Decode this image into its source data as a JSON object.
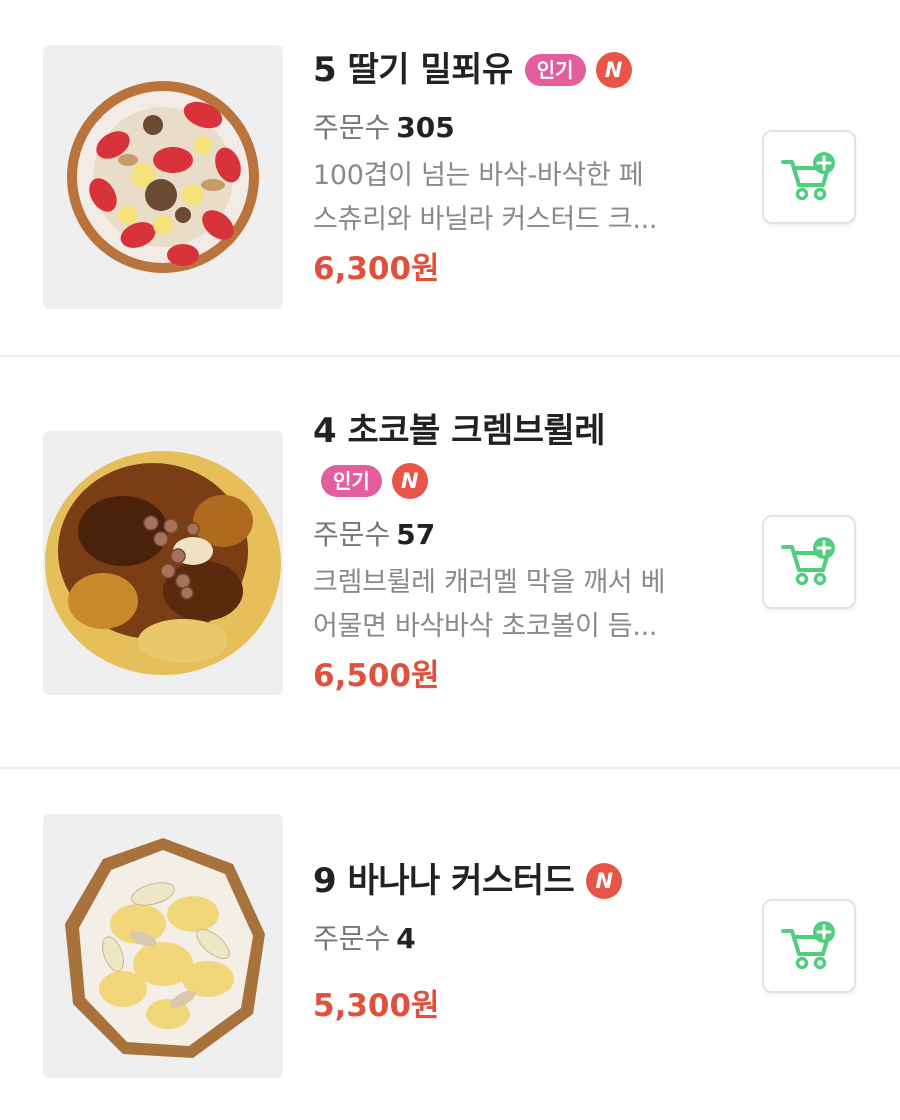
{
  "theme": {
    "price_color": "#e0503d",
    "popular_badge_color": "#e45d9e",
    "new_badge_color": "#e85447",
    "cart_icon_color": "#4fcf7e"
  },
  "menu_items": [
    {
      "title": "5 딸기 밀푀유",
      "badge_popular": "인기",
      "badge_new": "N",
      "orders_label": "주문수",
      "orders_count": "305",
      "description_lines": [
        "100겹이 넘는 바삭-바삭한 페",
        "스츄리와 바닐라 커스터드 크..."
      ],
      "price": "6,300원",
      "image_icon": "strawberry-millefeuille-photo",
      "cart_icon": "cart-add-icon"
    },
    {
      "title": "4 초코볼 크렘브륄레",
      "badge_popular": "인기",
      "badge_new": "N",
      "orders_label": "주문수",
      "orders_count": "57",
      "description_lines": [
        "크렘브륄레 캐러멜 막을 깨서 베",
        "어물면 바삭바삭 초코볼이 듬..."
      ],
      "price": "6,500원",
      "image_icon": "chocoball-creme-brulee-photo",
      "cart_icon": "cart-add-icon"
    },
    {
      "title": "9 바나나 커스터드",
      "badge_new": "N",
      "orders_label": "주문수",
      "orders_count": "4",
      "price": "5,300원",
      "image_icon": "banana-custard-photo",
      "cart_icon": "cart-add-icon"
    }
  ]
}
